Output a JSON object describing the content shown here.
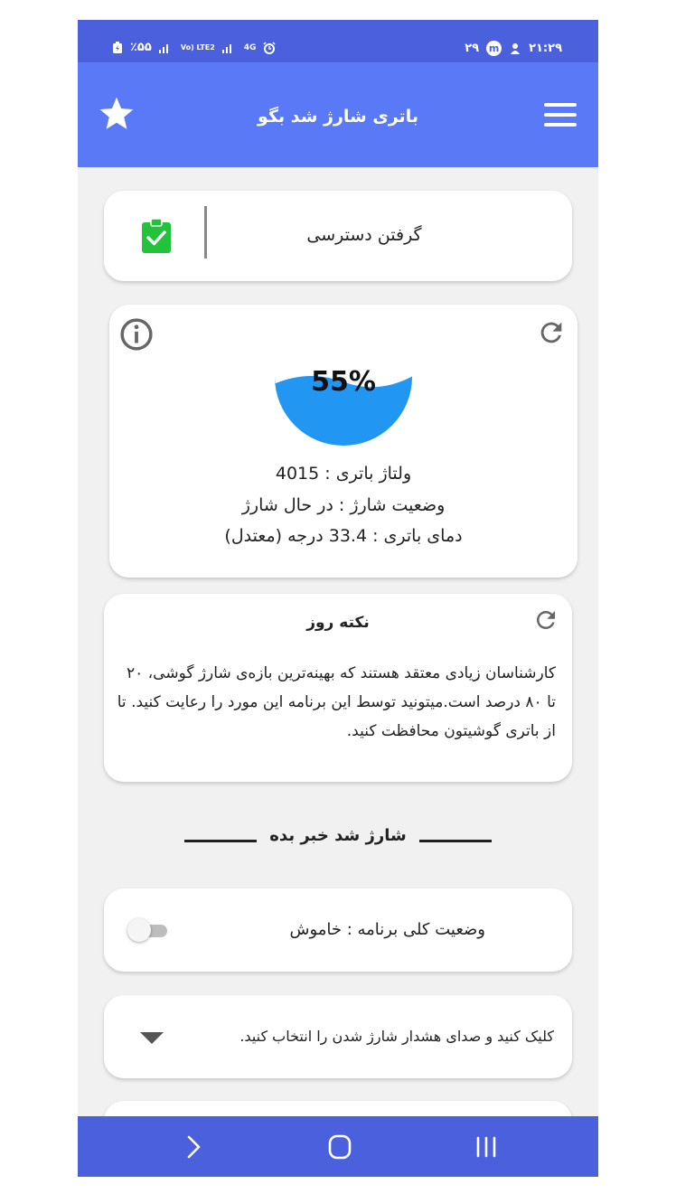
{
  "status_bar": {
    "left_text": "٪۵۵",
    "network_1": "Vo) LTE2",
    "network_2": "4G",
    "signal_icon": "signal-bars-icon",
    "alarm_icon": "alarm-icon",
    "right_number": "۲۹",
    "right_badge": "m",
    "time": "۲۱:۲۹"
  },
  "app_bar": {
    "title": "باتری شارژ شد بگو",
    "left_icon": "star-icon",
    "right_icon": "hamburger-menu-icon",
    "color": "#5a79f6"
  },
  "permission_card": {
    "label": "گرفتن دسترسی",
    "icon": "clipboard-check-icon",
    "icon_color": "#22c33a"
  },
  "battery_card": {
    "percent_text": "55%",
    "level": 0.55,
    "voltage_line": "ولتاژ باتری : 4015",
    "status_line": "وضعیت شارژ : در حال شارژ",
    "temperature_line": "دمای باتری : 33.4 درجه (معتدل)",
    "left_icon": "info-icon",
    "right_icon": "refresh-icon",
    "gauge_color": "#2196f3"
  },
  "tip_card": {
    "title": "نکته روز",
    "text": "کارشناسان زیادی معتقد هستند که بهینه‌ترین بازه‌ی شارژ گوشی، ۲۰ تا ۸۰ درصد است.میتونید توسط این برنامه این مورد را رعایت کنید. تا از باتری گوشیتون محافظت کنید.",
    "icon": "refresh-icon"
  },
  "section": {
    "title": "شارژ شد خبر بده"
  },
  "toggle_card": {
    "label": "وضعیت کلی برنامه : خاموش",
    "enabled": false
  },
  "sound_card": {
    "label": "کلیک کنید و صدای هشدار شارژ شدن را انتخاب کنید.",
    "icon": "dropdown-arrow-icon"
  },
  "nav_bar": {
    "back_icon": "chevron-right-icon",
    "home_icon": "home-circle-icon",
    "recents_icon": "recents-icon",
    "color": "#4a60dc"
  }
}
